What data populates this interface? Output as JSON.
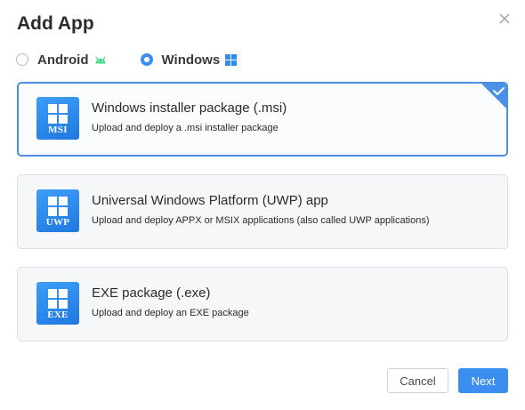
{
  "dialog": {
    "title": "Add App",
    "close_icon": "close-icon"
  },
  "platforms": [
    {
      "label": "Android",
      "selected": false,
      "icon": "android-icon"
    },
    {
      "label": "Windows",
      "selected": true,
      "icon": "windows-icon"
    }
  ],
  "packages": [
    {
      "title": "Windows installer package (.msi)",
      "description": "Upload and deploy a .msi installer package",
      "badge": "MSI",
      "selected": true
    },
    {
      "title": "Universal Windows Platform (UWP) app",
      "description": "Upload and deploy APPX or MSIX applications (also called UWP applications)",
      "badge": "UWP",
      "selected": false
    },
    {
      "title": "EXE package (.exe)",
      "description": "Upload and deploy an EXE package",
      "badge": "EXE",
      "selected": false
    }
  ],
  "footer": {
    "cancel_label": "Cancel",
    "next_label": "Next"
  },
  "colors": {
    "accent": "#3b8ef0",
    "android_green": "#3ddc84",
    "windows_blue": "#2f8cf0"
  }
}
